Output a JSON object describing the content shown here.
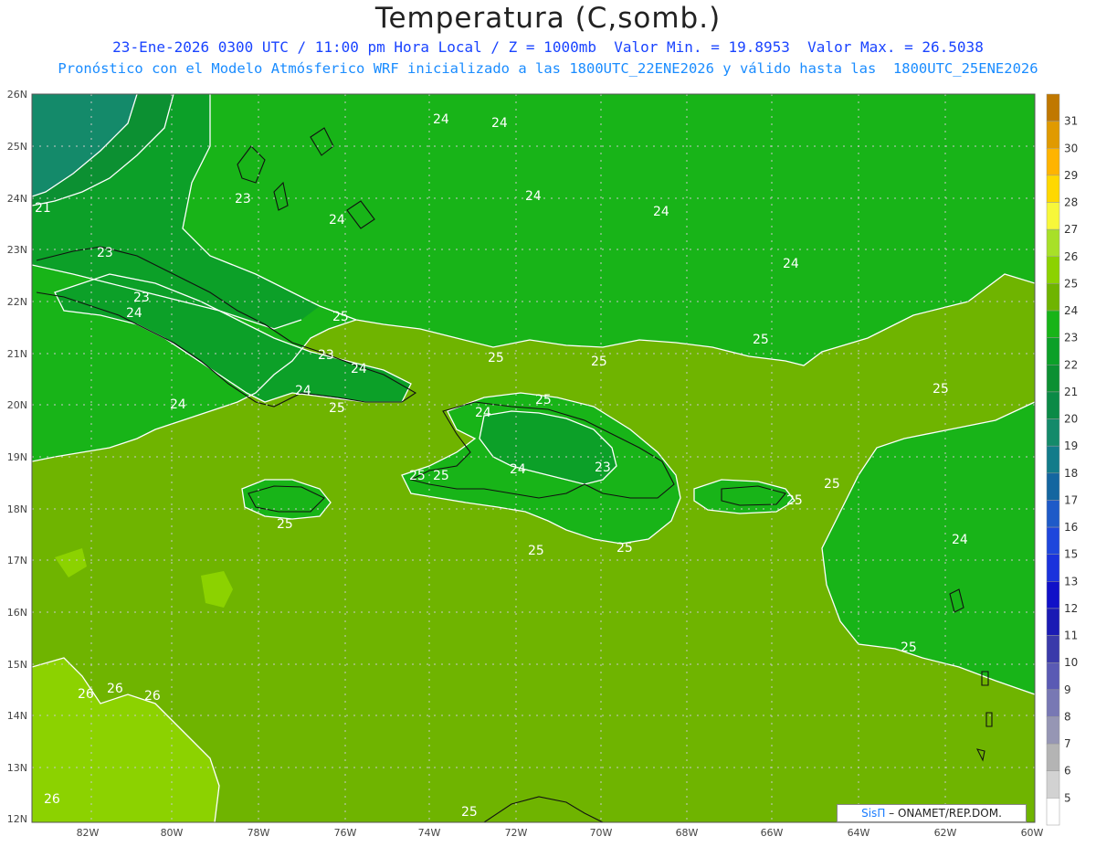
{
  "header": {
    "title": "Temperatura (C,somb.)",
    "line1": "23-Ene-2026 0300 UTC / 11:00 pm Hora Local / Z = 1000mb  Valor Min. = 19.8953  Valor Max. = 26.5038",
    "line2": "Pronóstico con el Modelo Atmósferico WRF inicializado a las 1800UTC_22ENE2026 y válido hasta las  1800UTC_25ENE2026"
  },
  "map": {
    "lat_labels": [
      "26N",
      "25N",
      "24N",
      "23N",
      "22N",
      "21N",
      "20N",
      "19N",
      "18N",
      "17N",
      "16N",
      "15N",
      "14N",
      "13N",
      "12N"
    ],
    "lon_labels": [
      "82W",
      "80W",
      "78W",
      "76W",
      "74W",
      "72W",
      "70W",
      "68W",
      "66W",
      "64W",
      "62W",
      "60W"
    ],
    "contour_labels": [
      "24",
      "24",
      "21",
      "23",
      "24",
      "24",
      "24",
      "24",
      "23",
      "23",
      "24",
      "25",
      "23",
      "24",
      "25",
      "25",
      "24",
      "25",
      "24",
      "25",
      "25",
      "25",
      "24",
      "25",
      "23",
      "24",
      "25",
      "25",
      "25",
      "25",
      "25",
      "25",
      "24",
      "26",
      "26",
      "26",
      "26",
      "25",
      "25"
    ]
  },
  "colorbar": {
    "labels": [
      "31",
      "30",
      "29",
      "28",
      "27",
      "26",
      "25",
      "24",
      "23",
      "22",
      "21",
      "20",
      "19",
      "18",
      "17",
      "16",
      "15",
      "13",
      "12",
      "11",
      "10",
      "9",
      "8",
      "7",
      "6",
      "5"
    ],
    "colors": [
      "#c07800",
      "#e09a00",
      "#ffb400",
      "#ffd800",
      "#f7f73a",
      "#a8e028",
      "#8cd200",
      "#6fb400",
      "#18b418",
      "#0ca028",
      "#0c9032",
      "#0b8a46",
      "#148a6a",
      "#127c8a",
      "#1466a0",
      "#1e5ac8",
      "#1e46dc",
      "#1a32dc",
      "#1010c8",
      "#1a1ab4",
      "#3a3aaa",
      "#5a5ab4",
      "#7878b4",
      "#9696b4",
      "#b4b4b4",
      "#d2d2d2",
      "#ffffff"
    ]
  },
  "credit": {
    "sis": "SisΠ",
    "org": "– ONAMET/REP.DOM."
  }
}
